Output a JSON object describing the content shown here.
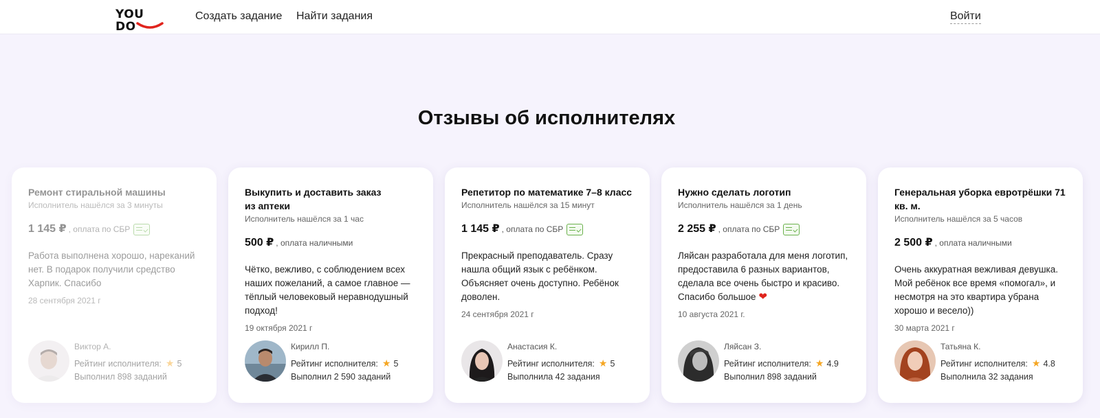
{
  "header": {
    "logo_text": "YOU DO",
    "nav": [
      "Создать задание",
      "Найти задания"
    ],
    "login": "Войти",
    "accent_color": "#e0241d"
  },
  "section": {
    "title": "Отзывы об исполнителях"
  },
  "reviews": [
    {
      "title": "Ремонт стиральной машины",
      "found": "Исполнитель нашёлся за 3 минуты",
      "price": "1 145 ₽",
      "payment": ", оплата по СБР",
      "payment_icon": "sbp-icon",
      "text": "Работа выполнена хорошо, нареканий нет. В подарок получили средство Харпик. Спасибо",
      "date": "28 сентября 2021 г",
      "name": "Виктор А.",
      "rating_label": "Рейтинг исполнителя:",
      "rating": "5",
      "tasks": "Выполнил 898 заданий"
    },
    {
      "title": "Выкупить и доставить заказ из аптеки",
      "found": "Исполнитель нашёлся за 1 час",
      "price": "500 ₽",
      "payment": ", оплата наличными",
      "text": "Чётко, вежливо, с соблюдением всех наших пожеланий, а самое главное — тёплый человековый неравнодушный подход!",
      "date": "19 октября 2021 г",
      "name": "Кирилл П.",
      "rating_label": "Рейтинг исполнителя:",
      "rating": "5",
      "tasks": "Выполнил 2 590 заданий"
    },
    {
      "title": "Репетитор по математике 7–8 класс",
      "found": "Исполнитель нашёлся за 15 минут",
      "price": "1 145 ₽",
      "payment": ", оплата по СБР",
      "payment_icon": "sbp-icon",
      "text": "Прекрасный преподаватель. Сразу нашла общий язык с ребёнком. Объясняет очень доступно. Ребёнок доволен.",
      "date": "24 сентября 2021 г",
      "name": "Анастасия К.",
      "rating_label": "Рейтинг исполнителя:",
      "rating": "5",
      "tasks": "Выполнила 42 задания"
    },
    {
      "title": "Нужно сделать логотип",
      "found": "Исполнитель нашёлся за 1 день",
      "price": "2 255 ₽",
      "payment": ", оплата по СБР",
      "payment_icon": "sbp-icon",
      "text": "Ляйсан разработала для меня логотип, предоставила 6 разных вариантов, сделала все очень быстро и красиво. Спасибо большое",
      "emoji": "❤",
      "date": "10 августа 2021 г.",
      "name": "Ляйсан З.",
      "rating_label": "Рейтинг исполнителя:",
      "rating": "4.9",
      "tasks": "Выполнил 898 заданий"
    },
    {
      "title": "Генеральная уборка евротрёшки 71 кв. м.",
      "found": "Исполнитель нашёлся за 5 часов",
      "price": "2 500 ₽",
      "payment": ", оплата наличными",
      "text": "Очень аккуратная вежливая девушка. Мой ребёнок все время «помогал», и несмотря на это квартира убрана хорошо и весело))",
      "date": "30 марта 2021 г",
      "name": "Татьяна К.",
      "rating_label": "Рейтинг исполнителя:",
      "rating": "4.8",
      "tasks": "Выполнила 32 задания"
    }
  ]
}
